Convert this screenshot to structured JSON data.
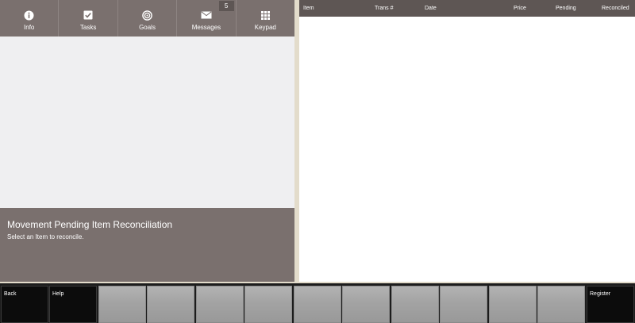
{
  "tabs": [
    {
      "label": "Info",
      "icon": "info-icon"
    },
    {
      "label": "Tasks",
      "icon": "checkbox-icon"
    },
    {
      "label": "Goals",
      "icon": "target-icon"
    },
    {
      "label": "Messages",
      "icon": "envelope-icon",
      "badge": "5"
    },
    {
      "label": "Keypad",
      "icon": "keypad-icon"
    }
  ],
  "info": {
    "title": "Movement Pending Item Reconciliation",
    "text": "Select an Item to reconcile."
  },
  "table": {
    "columns": [
      "Item",
      "Trans #",
      "Date",
      "Price",
      "Pending",
      "Reconciled"
    ],
    "rows": []
  },
  "function_keys": {
    "back": "Back",
    "help": "Help",
    "register": "Register"
  },
  "colors": {
    "panel": "#7a706e",
    "header": "#5e5654",
    "background": "#e3dccb"
  }
}
